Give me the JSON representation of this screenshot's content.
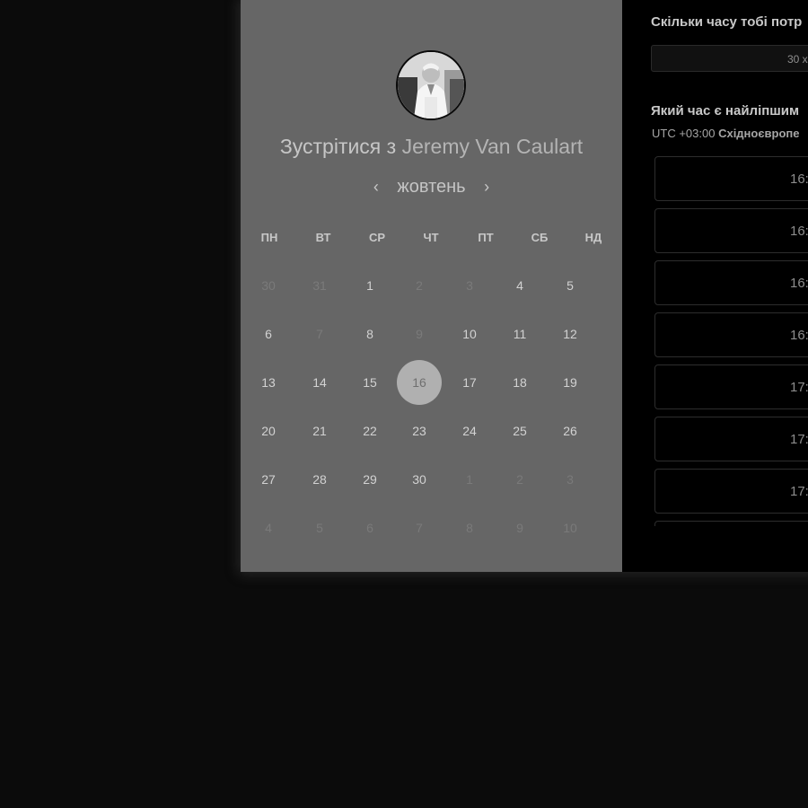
{
  "scheduler": {
    "title_prefix": "Зустрітися з",
    "host_name": "Jeremy Van Caulart",
    "month": "жовтень",
    "prev_arrow": "‹",
    "next_arrow": "›",
    "weekdays": [
      "ПН",
      "ВТ",
      "СР",
      "ЧТ",
      "ПТ",
      "СБ",
      "НД"
    ],
    "weeks": [
      [
        {
          "d": "30",
          "m": true
        },
        {
          "d": "31",
          "m": true
        },
        {
          "d": "1",
          "m": false
        },
        {
          "d": "2",
          "m": true
        },
        {
          "d": "3",
          "m": true
        },
        {
          "d": "4",
          "m": false
        },
        {
          "d": "5",
          "m": false
        }
      ],
      [
        {
          "d": "6",
          "m": false
        },
        {
          "d": "7",
          "m": true
        },
        {
          "d": "8",
          "m": false
        },
        {
          "d": "9",
          "m": true
        },
        {
          "d": "10",
          "m": false
        },
        {
          "d": "11",
          "m": false
        },
        {
          "d": "12",
          "m": false
        }
      ],
      [
        {
          "d": "13",
          "m": false
        },
        {
          "d": "14",
          "m": false
        },
        {
          "d": "15",
          "m": false
        },
        {
          "d": "16",
          "m": false,
          "s": true
        },
        {
          "d": "17",
          "m": false
        },
        {
          "d": "18",
          "m": false
        },
        {
          "d": "19",
          "m": false
        }
      ],
      [
        {
          "d": "20",
          "m": false
        },
        {
          "d": "21",
          "m": false
        },
        {
          "d": "22",
          "m": false
        },
        {
          "d": "23",
          "m": false
        },
        {
          "d": "24",
          "m": false
        },
        {
          "d": "25",
          "m": false
        },
        {
          "d": "26",
          "m": false
        }
      ],
      [
        {
          "d": "27",
          "m": false
        },
        {
          "d": "28",
          "m": false
        },
        {
          "d": "29",
          "m": false
        },
        {
          "d": "30",
          "m": false
        },
        {
          "d": "1",
          "m": true
        },
        {
          "d": "2",
          "m": true
        },
        {
          "d": "3",
          "m": true
        }
      ],
      [
        {
          "d": "4",
          "m": true
        },
        {
          "d": "5",
          "m": true
        },
        {
          "d": "6",
          "m": true
        },
        {
          "d": "7",
          "m": true
        },
        {
          "d": "8",
          "m": true
        },
        {
          "d": "9",
          "m": true
        },
        {
          "d": "10",
          "m": true
        }
      ]
    ],
    "selected_day": "16"
  },
  "booking": {
    "duration_question": "Скільки часу тобі потр",
    "duration_value": "30 х",
    "time_question": "Який час є найліпшим",
    "tz_offset": "UTC +03:00",
    "tz_name": "Східноєвропе",
    "slots": [
      "16:",
      "16:",
      "16:",
      "16:",
      "17:",
      "17:",
      "17:",
      ""
    ]
  },
  "colors": {
    "left_panel": "#666666",
    "right_panel": "#000000",
    "page_background": "#0b0b0b",
    "selected_day": "#b0b0b0"
  },
  "icons": {
    "avatar": "host-photo"
  }
}
